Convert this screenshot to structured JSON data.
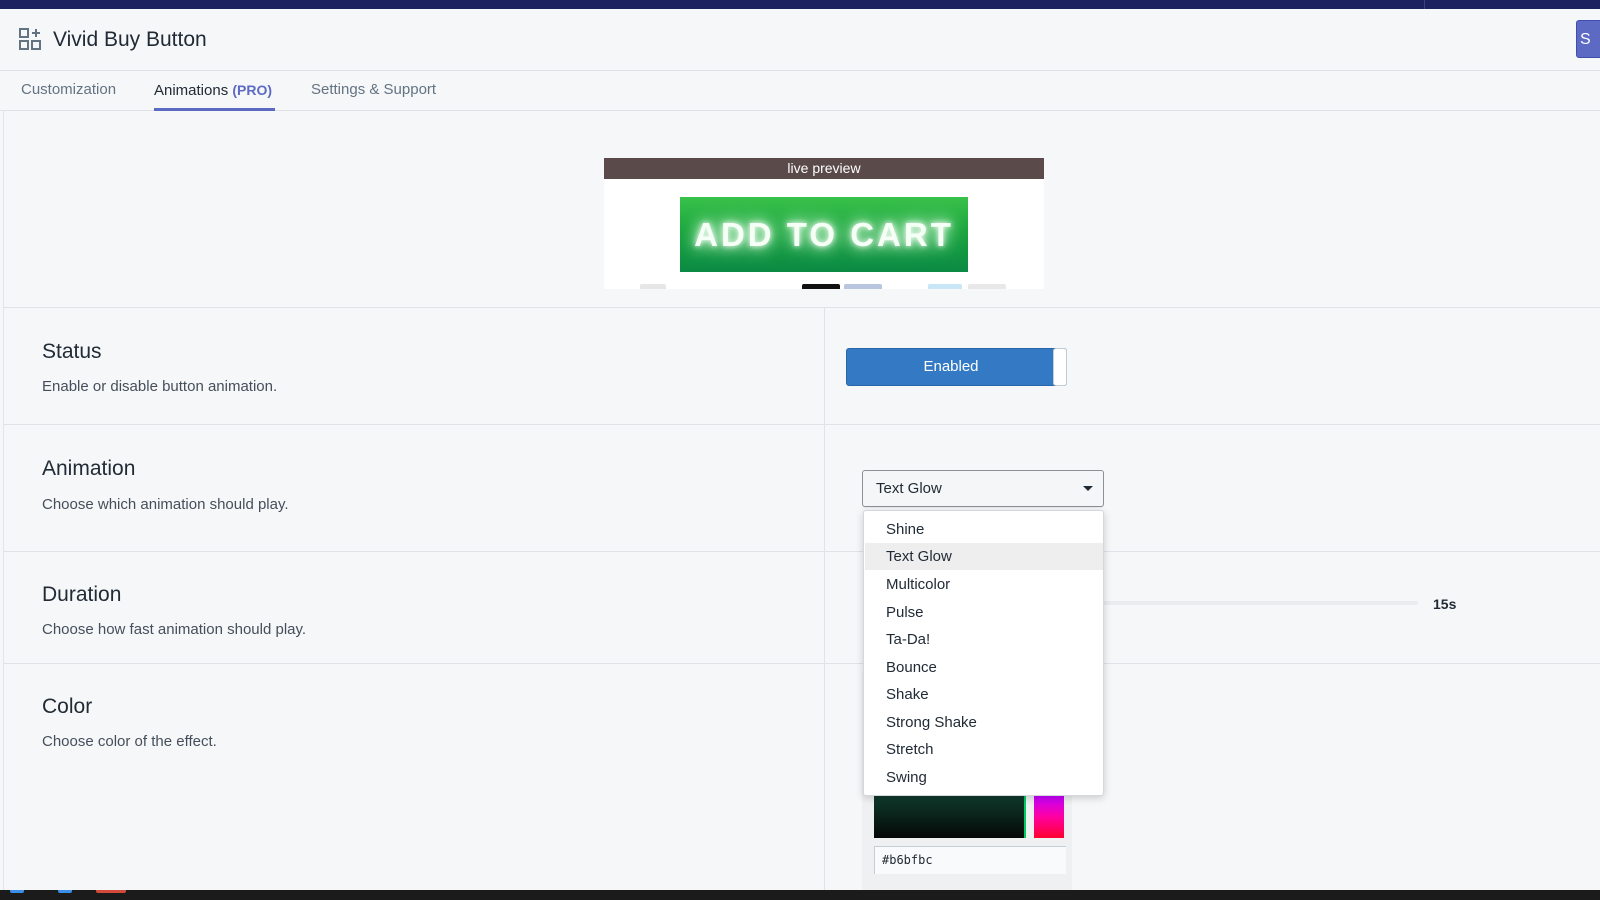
{
  "app": {
    "title": "Vivid Buy Button",
    "save_label": "S",
    "icon": "apps-grid-icon"
  },
  "tabs": [
    {
      "label": "Customization",
      "active": false
    },
    {
      "label": "Animations",
      "badge": "(PRO)",
      "active": true
    },
    {
      "label": "Settings & Support",
      "active": false
    }
  ],
  "preview": {
    "header": "live preview",
    "button_text": "ADD TO CART"
  },
  "sections": {
    "status": {
      "title": "Status",
      "description": "Enable or disable button animation.",
      "toggle_label": "Enabled",
      "enabled": true
    },
    "animation": {
      "title": "Animation",
      "description": "Choose which animation should play.",
      "selected": "Text Glow",
      "options": [
        "Shine",
        "Text Glow",
        "Multicolor",
        "Pulse",
        "Ta-Da!",
        "Bounce",
        "Shake",
        "Strong Shake",
        "Stretch",
        "Swing"
      ]
    },
    "duration": {
      "title": "Duration",
      "description": "Choose how fast animation should play.",
      "value": "15s"
    },
    "color": {
      "title": "Color",
      "description": "Choose color of the effect.",
      "hex": "#b6bfbc"
    }
  },
  "colors": {
    "accent": "#5c6ac4",
    "toggle": "#3379c4",
    "topbar": "#1c2260"
  }
}
